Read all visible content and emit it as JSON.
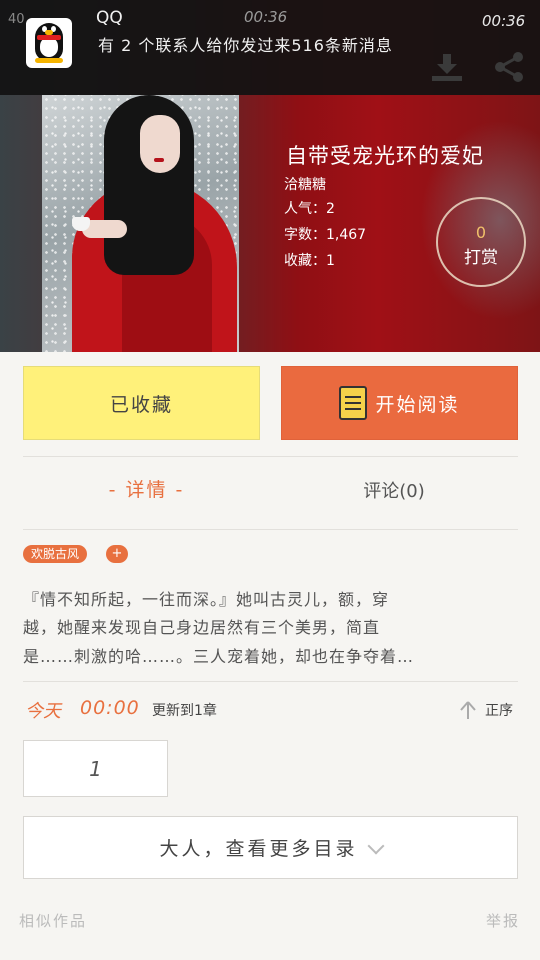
{
  "status_bar": {
    "left_text": "40",
    "time_center": "00:36",
    "time_right": "00:36"
  },
  "notification": {
    "app_name": "QQ",
    "message": "有 2 个联系人给你发过来516条新消息"
  },
  "book": {
    "title": "自带受宠光环的爱妃",
    "author": "洽糖糖",
    "popularity": "人气：2",
    "word_count": "字数：1,467",
    "favorites": "收藏：1",
    "tip_count": "0",
    "tip_label": "打赏"
  },
  "actions": {
    "favorited_label": "已收藏",
    "read_label": "开始阅读"
  },
  "tabs": {
    "detail": "- 详情 -",
    "comments": "评论(0)"
  },
  "tags": {
    "items": [
      "欢脱古风"
    ],
    "add": "+"
  },
  "synopsis": {
    "lines": [
      "『情不知所起，一往而深。』她叫古灵儿，额，穿",
      "越，她醒来发现自己身边居然有三个美男，简直",
      "是……刺激的哈……。三人宠着她，却也在争夺着…"
    ]
  },
  "update": {
    "today": "今天",
    "time": "00:00",
    "text": "更新到1章",
    "sort_label": "正序"
  },
  "chapter_input": {
    "value": "1"
  },
  "more_catalog": {
    "label": "大人，查看更多目录"
  },
  "footer": {
    "similar": "相似作品",
    "report": "举报"
  },
  "colors": {
    "accent": "#e8703f",
    "favorite_bg": "#fff17a",
    "read_bg": "#ea6a3f"
  }
}
